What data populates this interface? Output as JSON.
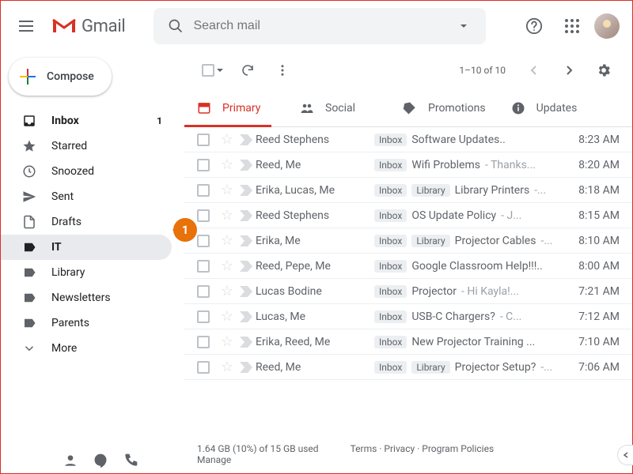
{
  "header": {
    "product": "Gmail",
    "search_placeholder": "Search mail"
  },
  "compose_label": "Compose",
  "sidebar": {
    "items": [
      {
        "icon": "inbox",
        "label": "Inbox",
        "count": "1",
        "bold": true
      },
      {
        "icon": "star",
        "label": "Starred"
      },
      {
        "icon": "clock",
        "label": "Snoozed"
      },
      {
        "icon": "send",
        "label": "Sent"
      },
      {
        "icon": "file",
        "label": "Drafts"
      },
      {
        "icon": "label",
        "label": "IT",
        "active": true
      },
      {
        "icon": "label",
        "label": "Library"
      },
      {
        "icon": "label",
        "label": "Newsletters"
      },
      {
        "icon": "label",
        "label": "Parents"
      },
      {
        "icon": "chevron",
        "label": "More"
      }
    ]
  },
  "toolbar": {
    "pagecount": "1–10 of 10"
  },
  "tabs": [
    {
      "key": "primary",
      "label": "Primary",
      "active": true
    },
    {
      "key": "social",
      "label": "Social"
    },
    {
      "key": "promotions",
      "label": "Promotions"
    },
    {
      "key": "updates",
      "label": "Updates"
    }
  ],
  "messages": [
    {
      "sender": "Reed Stephens",
      "labels": [
        "Inbox"
      ],
      "subject": "Software Updates..",
      "snippet": "",
      "time": "8:23 AM"
    },
    {
      "sender": "Reed, Me",
      "labels": [
        "Inbox"
      ],
      "subject": "Wifi Problems",
      "snippet": " - Thanks...",
      "time": "8:20 AM"
    },
    {
      "sender": "Erika, Lucas, Me",
      "labels": [
        "Inbox",
        "Library"
      ],
      "subject": "Library Printers",
      "snippet": " -...",
      "time": "8:18 AM"
    },
    {
      "sender": "Reed Stephens",
      "labels": [
        "Inbox"
      ],
      "subject": "OS Update Policy",
      "snippet": " - J...",
      "time": "8:15 AM"
    },
    {
      "sender": "Erika, Me",
      "labels": [
        "Inbox",
        "Library"
      ],
      "subject": "Projector Cables",
      "snippet": " -...",
      "time": "8:10 AM"
    },
    {
      "sender": "Reed, Pepe, Me",
      "labels": [
        "Inbox"
      ],
      "subject": "Google Classroom Help!!!..",
      "snippet": "",
      "time": "8:00 AM"
    },
    {
      "sender": "Lucas Bodine",
      "labels": [
        "Inbox"
      ],
      "subject": "Projector",
      "snippet": " - Hi Kayla!...",
      "time": "7:21 AM"
    },
    {
      "sender": "Lucas, Me",
      "labels": [
        "Inbox"
      ],
      "subject": "USB-C Chargers?",
      "snippet": " - C...",
      "time": "7:12 AM"
    },
    {
      "sender": "Erika, Reed, Me",
      "labels": [
        "Inbox"
      ],
      "subject": "New Projector Training ...",
      "snippet": "",
      "time": "7:10 AM"
    },
    {
      "sender": "Reed, Me",
      "labels": [
        "Inbox",
        "Library"
      ],
      "subject": "Projector Setup?",
      "snippet": " -...",
      "time": "7:06 AM"
    }
  ],
  "footer": {
    "storage": "1.64 GB (10%) of 15 GB used",
    "manage": "Manage",
    "terms": "Terms",
    "privacy": "Privacy",
    "policies": "Program Policies"
  },
  "callout": {
    "num": "1"
  }
}
